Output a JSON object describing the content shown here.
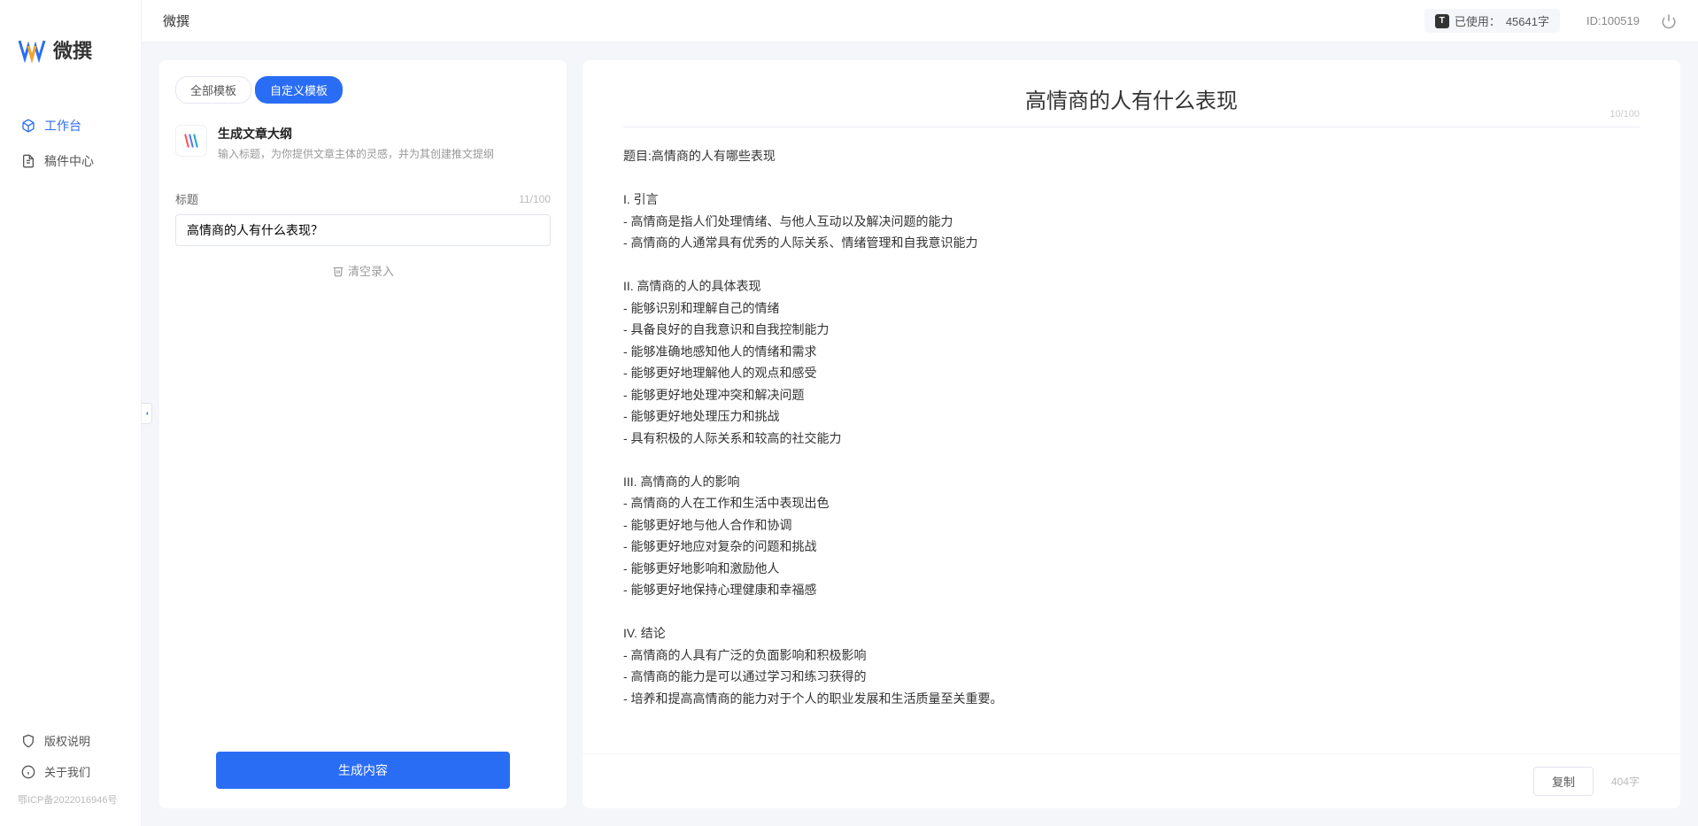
{
  "brand": {
    "name": "微撰"
  },
  "topbar": {
    "title": "微撰",
    "usage_label": "已使用：",
    "usage_value": "45641字",
    "id_label": "ID:",
    "id_value": "100519"
  },
  "sidebar": {
    "nav": [
      {
        "label": "工作台",
        "icon": "cube",
        "active": true
      },
      {
        "label": "稿件中心",
        "icon": "document",
        "active": false
      }
    ],
    "bottom": [
      {
        "label": "版权说明",
        "icon": "shield"
      },
      {
        "label": "关于我们",
        "icon": "info"
      }
    ],
    "icp": "鄂ICP备2022016946号"
  },
  "left": {
    "tabs": [
      {
        "label": "全部模板",
        "active": false
      },
      {
        "label": "自定义模板",
        "active": true
      }
    ],
    "template": {
      "title": "生成文章大纲",
      "desc": "输入标题，为你提供文章主体的灵感，并为其创建推文提纲"
    },
    "field": {
      "label": "标题",
      "counter": "11/100",
      "value": "高情商的人有什么表现？"
    },
    "clear": "清空录入",
    "generate": "生成内容"
  },
  "right": {
    "title": "高情商的人有什么表现",
    "title_counter": "10/100",
    "body": "题目:高情商的人有哪些表现\n\nI. 引言\n- 高情商是指人们处理情绪、与他人互动以及解决问题的能力\n- 高情商的人通常具有优秀的人际关系、情绪管理和自我意识能力\n\nII. 高情商的人的具体表现\n- 能够识别和理解自己的情绪\n- 具备良好的自我意识和自我控制能力\n- 能够准确地感知他人的情绪和需求\n- 能够更好地理解他人的观点和感受\n- 能够更好地处理冲突和解决问题\n- 能够更好地处理压力和挑战\n- 具有积极的人际关系和较高的社交能力\n\nIII. 高情商的人的影响\n- 高情商的人在工作和生活中表现出色\n- 能够更好地与他人合作和协调\n- 能够更好地应对复杂的问题和挑战\n- 能够更好地影响和激励他人\n- 能够更好地保持心理健康和幸福感\n\nIV. 结论\n- 高情商的人具有广泛的负面影响和积极影响\n- 高情商的能力是可以通过学习和练习获得的\n- 培养和提高高情商的能力对于个人的职业发展和生活质量至关重要。",
    "copy": "复制",
    "word_count": "404字"
  }
}
